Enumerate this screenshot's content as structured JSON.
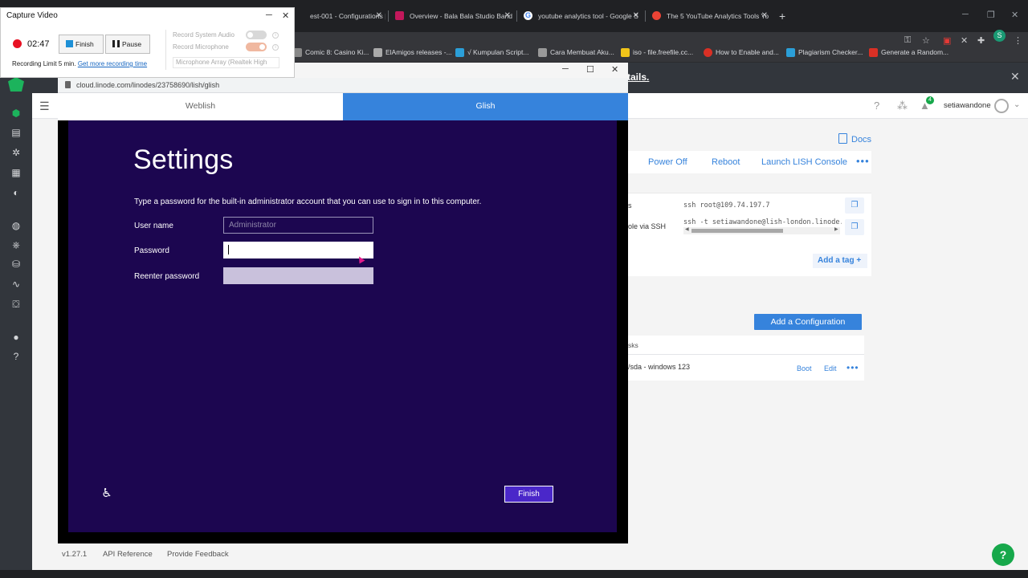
{
  "browser": {
    "tabs": [
      {
        "label": "est-001 - Configurations | Li",
        "color": "#1cb35c"
      },
      {
        "label": "Overview - Bala Bala Studio Band",
        "color": "#c2185b"
      },
      {
        "label": "youtube analytics tool - Google S",
        "color": "#4285f4"
      },
      {
        "label": "The 5 YouTube Analytics Tools Yo",
        "color": "#ea4335"
      }
    ],
    "new_tab": "+",
    "profile_initial": "S",
    "bookmarks": [
      {
        "label": "Comic 8: Casino Ki...",
        "color": "#888888"
      },
      {
        "label": "ElAmigos releases -...",
        "color": "#aaaaaa"
      },
      {
        "label": "√ Kumpulan Script...",
        "color": "#2b9fd8"
      },
      {
        "label": "Cara Membuat Aku...",
        "color": "#999999"
      },
      {
        "label": "iso - file.freefile.cc...",
        "color": "#f0c419"
      },
      {
        "label": "How to Enable and...",
        "color": "#d93025"
      },
      {
        "label": "Plagiarism Checker...",
        "color": "#2b9fd8"
      },
      {
        "label": "Generate a Random...",
        "color": "#d93025"
      }
    ]
  },
  "capture": {
    "title": "Capture Video",
    "time": "02:47",
    "finish_label": "Finish",
    "pause_label": "Pause",
    "record_system_audio": "Record System Audio",
    "record_microphone": "Record Microphone",
    "microphone_device": "Microphone Array (Realtek High",
    "limit_text": "Recording Limit 5 min.",
    "limit_link": "Get more recording time"
  },
  "popup": {
    "url": "cloud.linode.com/linodes/23758690/lish/glish",
    "tab_weblish": "Weblish",
    "tab_glish": "Glish"
  },
  "windows_setup": {
    "title": "Settings",
    "description": "Type a password for the built-in administrator account that you can use to sign in to this computer.",
    "username_label": "User name",
    "username_value": "Administrator",
    "password_label": "Password",
    "reenter_label": "Reenter password",
    "finish_label": "Finish"
  },
  "linode": {
    "banner_link": "tails.",
    "user": "setiawandone",
    "notifications": "4",
    "docs": "Docs",
    "actions": {
      "power_off": "Power Off",
      "reboot": "Reboot",
      "launch_lish": "Launch LISH Console"
    },
    "access": {
      "ssh_label": "s",
      "ssh_cmd": "ssh root@109.74.197.7",
      "lish_label": "ole via SSH",
      "lish_cmd": "ssh -t setiawandone@lish-london.linode.com"
    },
    "add_tag": "Add a tag",
    "add_config": "Add a Configuration",
    "config_header": "sks",
    "config_row": "/sda - windows 123",
    "boot": "Boot",
    "edit": "Edit"
  },
  "footer": {
    "version": "v1.27.1",
    "api": "API Reference",
    "feedback": "Provide Feedback"
  }
}
